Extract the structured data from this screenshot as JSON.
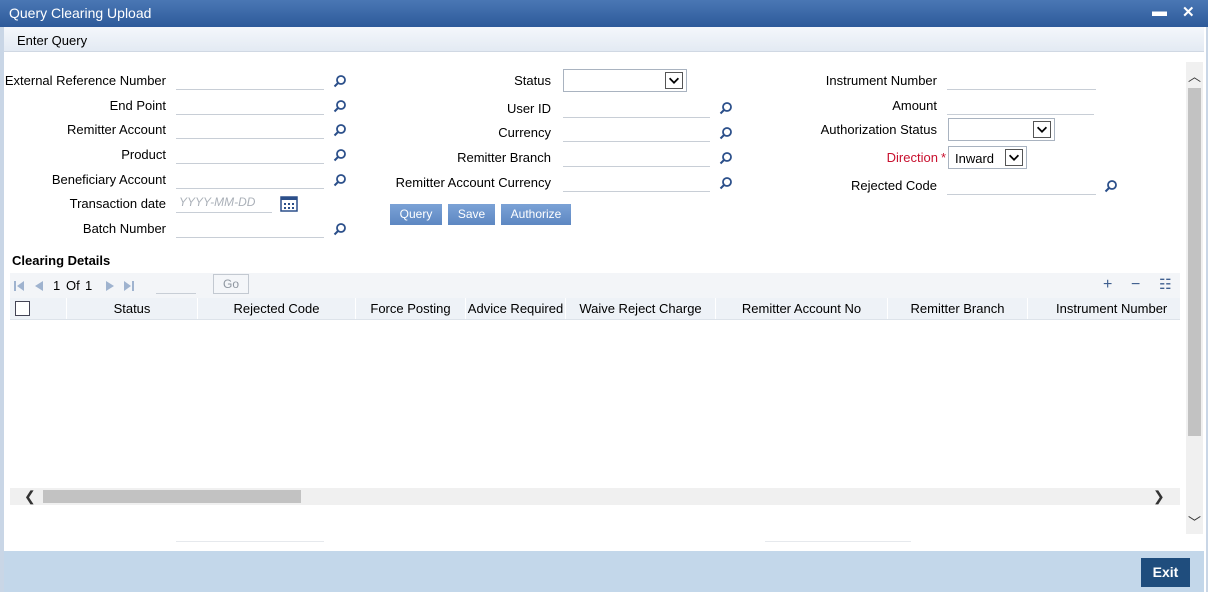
{
  "window": {
    "title": "Query Clearing Upload",
    "minimize_icon": "minimize-icon",
    "close_icon": "close-icon"
  },
  "menu": {
    "items": [
      "Enter Query"
    ]
  },
  "form": {
    "external_reference_number": {
      "label": "External Reference Number",
      "value": ""
    },
    "end_point": {
      "label": "End Point",
      "value": ""
    },
    "remitter_account": {
      "label": "Remitter Account",
      "value": ""
    },
    "product": {
      "label": "Product",
      "value": ""
    },
    "beneficiary_account": {
      "label": "Beneficiary Account",
      "value": ""
    },
    "transaction_date": {
      "label": "Transaction date",
      "value": "",
      "placeholder": "YYYY-MM-DD"
    },
    "batch_number": {
      "label": "Batch Number",
      "value": ""
    },
    "status": {
      "label": "Status",
      "value": ""
    },
    "user_id": {
      "label": "User ID",
      "value": ""
    },
    "currency": {
      "label": "Currency",
      "value": ""
    },
    "remitter_branch": {
      "label": "Remitter Branch",
      "value": ""
    },
    "remitter_account_currency": {
      "label": "Remitter Account Currency",
      "value": ""
    },
    "instrument_number": {
      "label": "Instrument Number",
      "value": ""
    },
    "amount": {
      "label": "Amount",
      "value": ""
    },
    "authorization_status": {
      "label": "Authorization Status",
      "value": ""
    },
    "direction": {
      "label": "Direction",
      "required_mark": "*",
      "value": "Inward"
    },
    "rejected_code": {
      "label": "Rejected Code",
      "value": ""
    }
  },
  "actions": {
    "query": "Query",
    "save": "Save",
    "authorize": "Authorize"
  },
  "clearing_details": {
    "title": "Clearing Details",
    "pager": {
      "current": "1",
      "of_label": "Of",
      "total": "1",
      "go_label": "Go"
    },
    "columns": [
      "Status",
      "Rejected Code",
      "Force Posting",
      "Advice Required",
      "Waive Reject Charge",
      "Remitter Account No",
      "Remitter Branch",
      "Instrument Number"
    ],
    "rows": []
  },
  "footer": {
    "exit_label": "Exit"
  },
  "colors": {
    "title_bar": "#2d5a9a",
    "button": "#5d87c2",
    "required": "#c8102e",
    "footer": "#c3d7ea",
    "exit_button": "#1f4d7d"
  }
}
